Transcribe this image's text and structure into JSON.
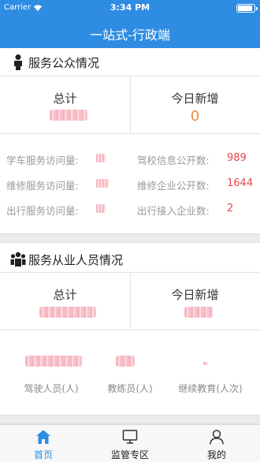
{
  "status_bar": {
    "carrier": "Carrier",
    "time": "3:34 PM"
  },
  "nav": {
    "title": "一站式-行政端"
  },
  "public_section": {
    "title": "服务公众情况",
    "total_label": "总计",
    "today_label": "今日新增",
    "today_value": "0",
    "metrics": [
      {
        "label": "学车服务访问量:",
        "value": ""
      },
      {
        "label": "驾校信息公开数:",
        "value": "989"
      },
      {
        "label": "维修服务访问量:",
        "value": ""
      },
      {
        "label": "维修企业公开数:",
        "value": "1644"
      },
      {
        "label": "出行服务访问量:",
        "value": ""
      },
      {
        "label": "出行接入企业数:",
        "value": "2"
      }
    ]
  },
  "staff_section": {
    "title": "服务从业人员情况",
    "total_label": "总计",
    "today_label": "今日新增",
    "categories": [
      {
        "label": "驾驶人员(人)"
      },
      {
        "label": "教练员(人)"
      },
      {
        "label": "继续教育(人次)"
      }
    ]
  },
  "tabs": [
    {
      "label": "首页",
      "icon": "home-icon",
      "active": true
    },
    {
      "label": "监管专区",
      "icon": "monitor-icon",
      "active": false
    },
    {
      "label": "我的",
      "icon": "user-icon",
      "active": false
    }
  ],
  "colors": {
    "primary": "#2f8ce3",
    "accent_orange": "#f08a3c",
    "accent_red": "#e5484d",
    "muted_text": "#999999"
  }
}
